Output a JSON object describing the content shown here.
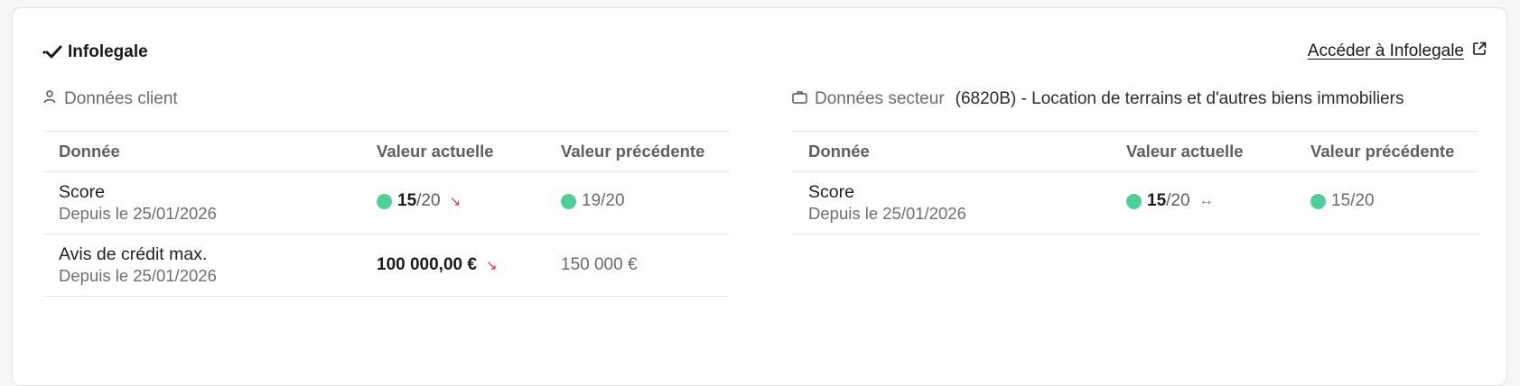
{
  "header": {
    "title": "Infolegale",
    "link_label": "Accéder à Infolegale"
  },
  "client_section": {
    "label": "Données client",
    "columns": [
      "Donnée",
      "Valeur actuelle",
      "Valeur précédente"
    ],
    "rows": [
      {
        "title": "Score",
        "since": "Depuis le 25/01/2026",
        "current_strong": "15",
        "current_rest": "/20",
        "trend": "↘",
        "previous": "19/20"
      },
      {
        "title": "Avis de crédit max.",
        "since": "Depuis le 25/01/2026",
        "current_strong": "100 000,00 €",
        "trend": "↘",
        "previous": "150 000 €"
      }
    ]
  },
  "sector_section": {
    "label": "Données secteur",
    "sector": "(6820B) - Location de terrains et d'autres biens immobiliers",
    "columns": [
      "Donnée",
      "Valeur actuelle",
      "Valeur précédente"
    ],
    "rows": [
      {
        "title": "Score",
        "since": "Depuis le 25/01/2026",
        "current_strong": "15",
        "current_rest": "/20",
        "trend": "↔",
        "previous": "15/20"
      }
    ]
  },
  "colors": {
    "score_dot": "#4fcf97",
    "trend_down": "#e0323b"
  }
}
